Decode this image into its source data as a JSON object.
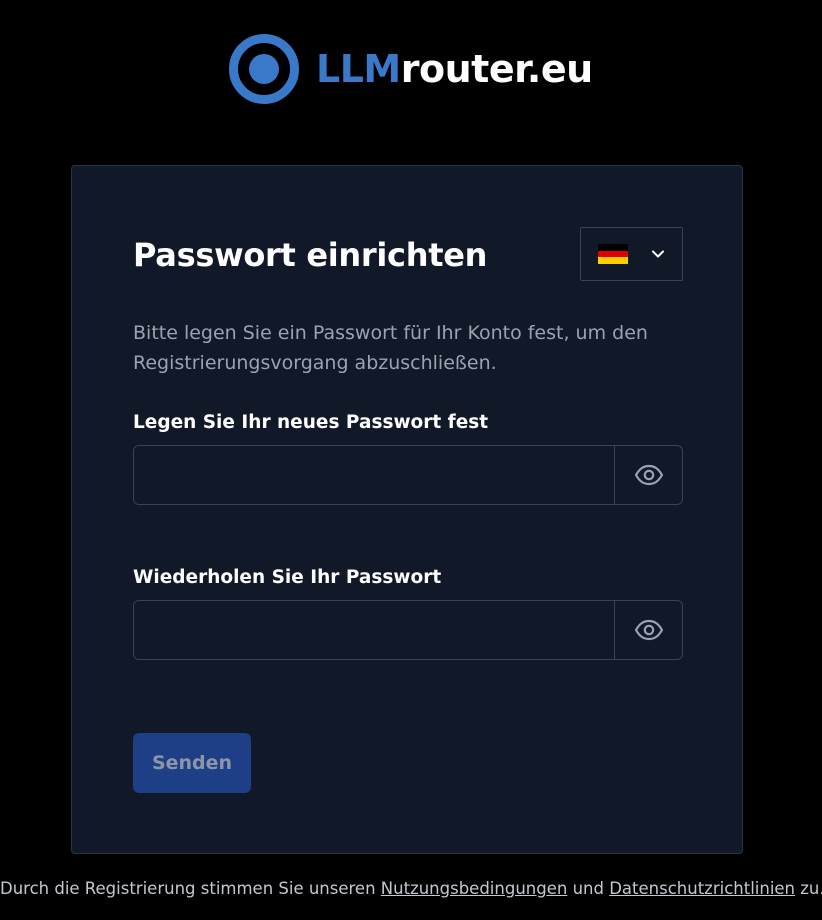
{
  "logo": {
    "accent_text": "LLM",
    "rest_text": "router.eu",
    "mark_icon": "ring-logo-icon",
    "accent_color": "#3a78c9"
  },
  "card": {
    "title": "Passwort einrichten",
    "language": {
      "selected": "Deutsch",
      "flag_icon": "flag-de-icon",
      "chevron_icon": "chevron-down-icon"
    },
    "description": "Bitte legen Sie ein Passwort für Ihr Konto fest, um den Registrierungsvorgang abzuschließen.",
    "fields": [
      {
        "label": "Legen Sie Ihr neues Passwort fest",
        "value": "",
        "placeholder": "",
        "toggle_icon": "eye-icon"
      },
      {
        "label": "Wiederholen Sie Ihr Passwort",
        "value": "",
        "placeholder": "",
        "toggle_icon": "eye-icon"
      }
    ],
    "submit_label": "Senden",
    "submit_color": "#1e3f86"
  },
  "footer": {
    "prefix": "Durch die Registrierung stimmen Sie unseren ",
    "terms_link": "Nutzungsbedingungen",
    "middle": " und ",
    "privacy_link": "Datenschutzrichtlinien",
    "suffix": " zu."
  }
}
